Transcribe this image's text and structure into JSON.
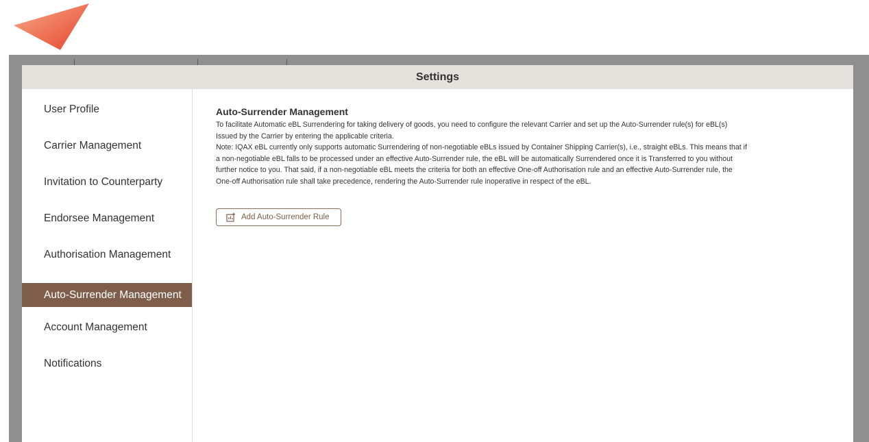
{
  "modal": {
    "title": "Settings"
  },
  "sidebar": {
    "items": [
      {
        "label": "User Profile",
        "active": false
      },
      {
        "label": "Carrier Management",
        "active": false
      },
      {
        "label": "Invitation to Counterparty",
        "active": false
      },
      {
        "label": "Endorsee Management",
        "active": false
      },
      {
        "label": "Authorisation Management",
        "active": false
      },
      {
        "label": "Auto-Surrender Management",
        "active": true
      },
      {
        "label": "Account Management",
        "active": false
      },
      {
        "label": "Notifications",
        "active": false
      }
    ]
  },
  "content": {
    "title": "Auto-Surrender Management",
    "lines": [
      "To facilitate Automatic eBL Surrendering for taking delivery of goods, you need to configure the relevant Carrier and set up the Auto-Surrender rule(s) for eBL(s)",
      "Issued by the Carrier by entering the applicable criteria.",
      "Note: IQAX eBL currently only supports automatic Surrendering of non-negotiable eBLs issued by Container Shipping Carrier(s), i.e., straight eBLs. This means that if",
      "a non-negotiable eBL falls to be processed under an effective Auto-Surrender rule, the eBL will be automatically Surrendered once it is Transferred to you without",
      "further notice to you. That said, if a non-negotiable eBL meets the criteria for both an effective One-off Authorisation rule and an effective Auto-Surrender rule, the",
      "One-off Authorisation rule shall take precedence, rendering the Auto-Surrender rule inoperative in respect of the eBL."
    ],
    "add_button_label": "Add Auto-Surrender Rule",
    "add_button_icon": "add-chart-icon"
  },
  "colors": {
    "accent": "#7e5e4b",
    "header_bg": "#e3e2dd",
    "logo_light": "#f9a98c",
    "logo_dark": "#e5452a"
  }
}
